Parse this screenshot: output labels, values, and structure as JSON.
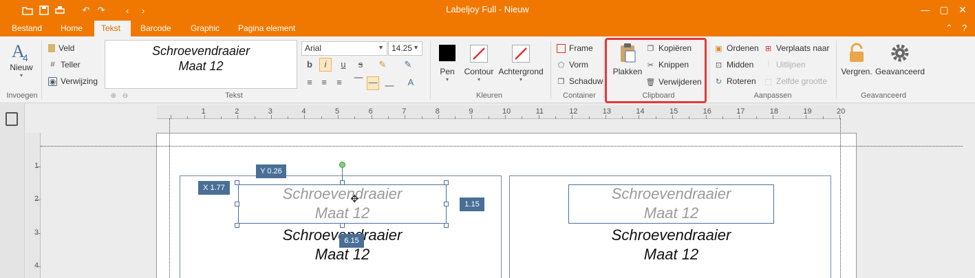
{
  "window": {
    "title": "Labeljoy Full - Nieuw"
  },
  "menu": {
    "tabs": [
      "Bestand",
      "Home",
      "Tekst",
      "Barcode",
      "Graphic",
      "Pagina element"
    ],
    "active": "Tekst"
  },
  "ribbon": {
    "invoegen": {
      "new_label": "Nieuw",
      "group": "Invoegen"
    },
    "fields": {
      "veld": "Veld",
      "teller": "Teller",
      "verwijzing": "Verwijzing"
    },
    "tekst": {
      "preview_line1": "Schroevendraaier",
      "preview_line2": "Maat 12",
      "font": "Arial",
      "size": "14.25",
      "group": "Tekst"
    },
    "kleuren": {
      "pen": "Pen",
      "contour": "Contour",
      "achtergrond": "Achtergrond",
      "group": "Kleuren",
      "pen_color": "#000000",
      "accent_red": "#d9332b"
    },
    "container": {
      "frame": "Frame",
      "vorm": "Vorm",
      "schaduw": "Schaduw",
      "group": "Container"
    },
    "clipboard": {
      "plakken": "Plakken",
      "kopieren": "Kopiëren",
      "knippen": "Knippen",
      "verwijderen": "Verwijderen",
      "group": "Clipboard"
    },
    "aanpassen": {
      "ordenen": "Ordenen",
      "midden": "Midden",
      "roteren": "Roteren",
      "verplaats": "Verplaats naar",
      "uitlijnen": "Uitlijnen",
      "zelfde": "Zelfde grootte",
      "group": "Aanpassen"
    },
    "geavanceerd": {
      "vergren": "Vergren.",
      "geavanceerd": "Geavanceerd",
      "group": "Geavanceerd"
    }
  },
  "ruler": {
    "h": [
      "1",
      "2",
      "3",
      "4",
      "5",
      "6",
      "7",
      "8",
      "9",
      "10",
      "11",
      "12",
      "13",
      "14",
      "15",
      "16",
      "17",
      "18",
      "19",
      "20"
    ],
    "v": [
      "1",
      "2",
      "3",
      "4"
    ]
  },
  "canvas": {
    "label1": {
      "ghost_line1": "Schroevendraaier",
      "ghost_line2": "Maat 12",
      "line1": "Schroevendraaier",
      "line2": "Maat 12"
    },
    "label2": {
      "ghost_line1": "Schroevendraaier",
      "ghost_line2": "Maat 12",
      "line1": "Schroevendraaier",
      "line2": "Maat 12"
    },
    "tags": {
      "x": "X 1.77",
      "y": "Y 0.26",
      "height": "1.15",
      "width": "6.15"
    }
  }
}
